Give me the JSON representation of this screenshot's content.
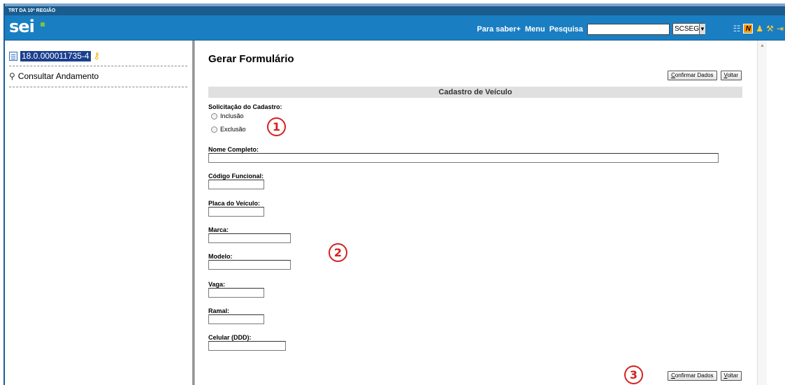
{
  "header": {
    "org": "TRT DA 10ª REGIÃO",
    "logo": "sei",
    "links": [
      "Para saber+",
      "Menu",
      "Pesquisa"
    ],
    "search_value": "",
    "unit": "SCSEG",
    "icons": [
      "view-list-icon",
      "n-note-icon",
      "user-icon",
      "tools-icon",
      "exit-icon"
    ]
  },
  "sidebar": {
    "process_number": "18.0.000011735-4",
    "consult_label": "Consultar Andamento"
  },
  "main": {
    "title": "Gerar Formulário",
    "confirm_label": "Confirmar Dados",
    "back_label": "Voltar",
    "form_title": "Cadastro de Veículo",
    "request_label": "Solicitação do Cadastro:",
    "options": [
      "Inclusão",
      "Exclusão"
    ],
    "fields": [
      {
        "label": "Nome Completo:",
        "value": ""
      },
      {
        "label": "Código Funcional:",
        "value": ""
      },
      {
        "label": "Placa do Veículo:",
        "value": ""
      },
      {
        "label": "Marca:",
        "value": ""
      },
      {
        "label": "Modelo:",
        "value": ""
      },
      {
        "label": "Vaga:",
        "value": ""
      },
      {
        "label": "Ramal:",
        "value": ""
      },
      {
        "label": "Celular (DDD):",
        "value": ""
      }
    ],
    "callouts": [
      "1",
      "2",
      "3"
    ]
  },
  "colors": {
    "header_bar": "#1a7ec2",
    "org_bar": "#1b5c8e",
    "callout": "#d42020",
    "form_header_bg": "#e0e0e0"
  }
}
